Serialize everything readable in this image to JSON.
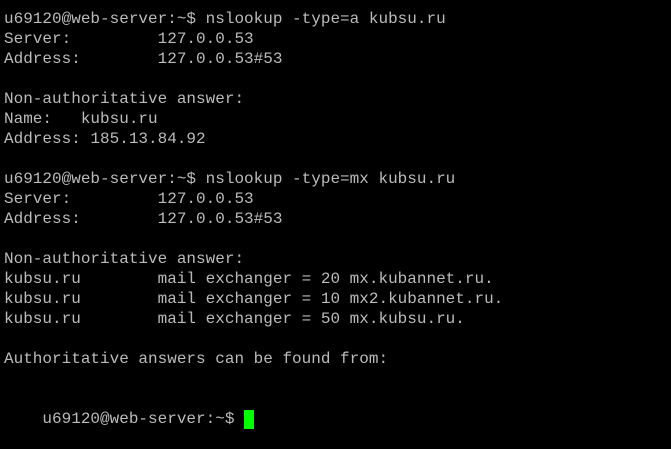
{
  "terminal": {
    "lines": [
      "u69120@web-server:~$ nslookup -type=a kubsu.ru",
      "Server:         127.0.0.53",
      "Address:        127.0.0.53#53",
      "",
      "Non-authoritative answer:",
      "Name:   kubsu.ru",
      "Address: 185.13.84.92",
      "",
      "u69120@web-server:~$ nslookup -type=mx kubsu.ru",
      "Server:         127.0.0.53",
      "Address:        127.0.0.53#53",
      "",
      "Non-authoritative answer:",
      "kubsu.ru        mail exchanger = 20 mx.kubannet.ru.",
      "kubsu.ru        mail exchanger = 10 mx2.kubannet.ru.",
      "kubsu.ru        mail exchanger = 50 mx.kubsu.ru.",
      "",
      "Authoritative answers can be found from:",
      ""
    ],
    "prompt": "u69120@web-server:~$ ",
    "colors": {
      "background": "#000000",
      "foreground": "#bbbbbb",
      "cursor": "#00ff00"
    }
  }
}
